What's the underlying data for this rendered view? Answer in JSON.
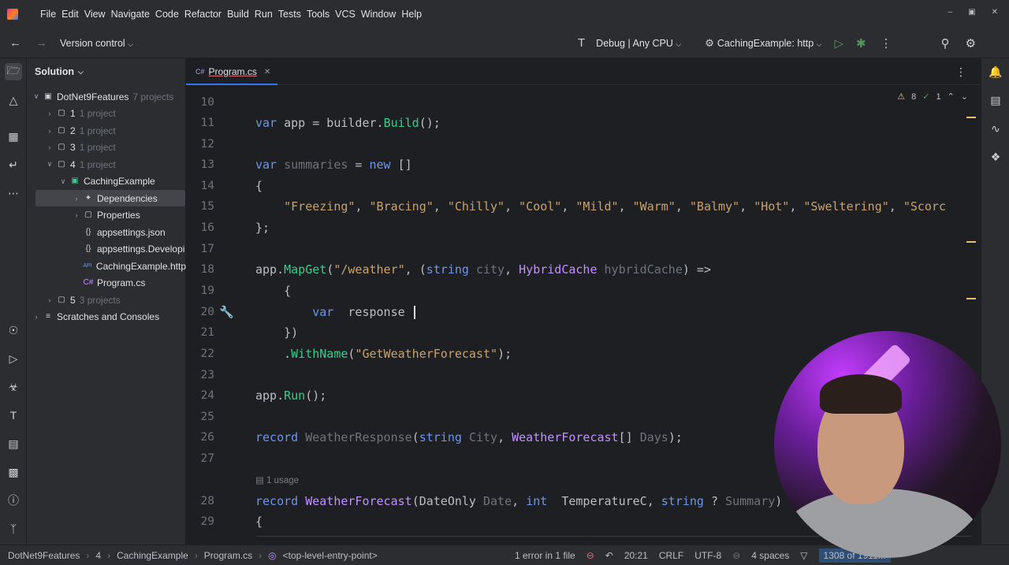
{
  "menu": [
    "File",
    "Edit",
    "View",
    "Navigate",
    "Code",
    "Refactor",
    "Build",
    "Run",
    "Tests",
    "Tools",
    "VCS",
    "Window",
    "Help"
  ],
  "toolbar": {
    "version_control": "Version control",
    "config": "Debug | Any CPU",
    "run_target": "CachingExample: http"
  },
  "project": {
    "title": "Solution",
    "tree": [
      {
        "indent": 0,
        "arrow": "down",
        "icon": "solution-icon",
        "label": "DotNet9Features",
        "hint": "7 projects"
      },
      {
        "indent": 1,
        "arrow": "right",
        "icon": "folder-icon",
        "label": "1",
        "hint": "1 project"
      },
      {
        "indent": 1,
        "arrow": "right",
        "icon": "folder-icon",
        "label": "2",
        "hint": "1 project"
      },
      {
        "indent": 1,
        "arrow": "right",
        "icon": "folder-icon",
        "label": "3",
        "hint": "1 project"
      },
      {
        "indent": 1,
        "arrow": "down",
        "icon": "folder-icon",
        "label": "4",
        "hint": "1 project"
      },
      {
        "indent": 2,
        "arrow": "down",
        "icon": "project-icon",
        "label": "CachingExample",
        "hint": ""
      },
      {
        "indent": 3,
        "arrow": "right",
        "icon": "dependencies-icon",
        "label": "Dependencies",
        "hint": ""
      },
      {
        "indent": 3,
        "arrow": "right",
        "icon": "properties-icon",
        "label": "Properties",
        "hint": ""
      },
      {
        "indent": 3,
        "arrow": "",
        "icon": "json-icon",
        "label": "appsettings.json",
        "hint": ""
      },
      {
        "indent": 3,
        "arrow": "",
        "icon": "json-icon",
        "label": "appsettings.Developi",
        "hint": ""
      },
      {
        "indent": 3,
        "arrow": "",
        "icon": "http-icon",
        "label": "CachingExample.http",
        "hint": ""
      },
      {
        "indent": 3,
        "arrow": "",
        "icon": "csharp-icon",
        "label": "Program.cs",
        "hint": ""
      },
      {
        "indent": 1,
        "arrow": "right",
        "icon": "folder-icon",
        "label": "5",
        "hint": "3 projects"
      },
      {
        "indent": 0,
        "arrow": "right",
        "icon": "scratches-icon",
        "label": "Scratches and Consoles",
        "hint": ""
      }
    ]
  },
  "editor": {
    "tab_label": "Program.cs",
    "tab_prefix": "C#",
    "inspections": {
      "warnings": "8",
      "weak": "1"
    },
    "usage_hint": "1 usage",
    "lines": [
      {
        "n": "10",
        "parts": []
      },
      {
        "n": "11",
        "parts": [
          [
            "kw",
            "var"
          ],
          [
            "",
            "app = builder."
          ],
          [
            "fn",
            "Build"
          ],
          [
            "",
            "();"
          ]
        ]
      },
      {
        "n": "12",
        "parts": []
      },
      {
        "n": "13",
        "parts": [
          [
            "kw",
            "var"
          ],
          [
            "",
            ""
          ],
          [
            "gray",
            "summaries"
          ],
          [
            "",
            " = "
          ],
          [
            "kw",
            "new"
          ],
          [
            "",
            "[]"
          ]
        ]
      },
      {
        "n": "14",
        "parts": [
          [
            "",
            "{"
          ]
        ]
      },
      {
        "n": "15",
        "parts": [
          [
            "",
            "    "
          ],
          [
            "str",
            "\"Freezing\""
          ],
          [
            "",
            ", "
          ],
          [
            "str",
            "\"Bracing\""
          ],
          [
            "",
            ", "
          ],
          [
            "str",
            "\"Chilly\""
          ],
          [
            "",
            ", "
          ],
          [
            "str",
            "\"Cool\""
          ],
          [
            "",
            ", "
          ],
          [
            "str",
            "\"Mild\""
          ],
          [
            "",
            ", "
          ],
          [
            "str",
            "\"Warm\""
          ],
          [
            "",
            ", "
          ],
          [
            "str",
            "\"Balmy\""
          ],
          [
            "",
            ", "
          ],
          [
            "str",
            "\"Hot\""
          ],
          [
            "",
            ", "
          ],
          [
            "str",
            "\"Sweltering\""
          ],
          [
            "",
            ", "
          ],
          [
            "str",
            "\"Scorc"
          ]
        ]
      },
      {
        "n": "16",
        "parts": [
          [
            "",
            "};"
          ]
        ]
      },
      {
        "n": "17",
        "parts": []
      },
      {
        "n": "18",
        "parts": [
          [
            "",
            "app."
          ],
          [
            "fn",
            "MapGet"
          ],
          [
            "",
            "("
          ],
          [
            "str",
            "\"/weather\""
          ],
          [
            "",
            ", ("
          ],
          [
            "kw",
            "string"
          ],
          [
            "",
            ""
          ],
          [
            "gray",
            "city"
          ],
          [
            "",
            ", "
          ],
          [
            "ty",
            "HybridCache"
          ],
          [
            "",
            ""
          ],
          [
            "gray",
            "hybridCache"
          ],
          [
            "",
            ") =>"
          ]
        ]
      },
      {
        "n": "19",
        "parts": [
          [
            "",
            "    {"
          ]
        ]
      },
      {
        "n": "20",
        "parts": [
          [
            "",
            "        "
          ],
          [
            "kw",
            "var"
          ],
          [
            "",
            " response "
          ]
        ]
      },
      {
        "n": "21",
        "parts": [
          [
            "",
            "    })"
          ]
        ]
      },
      {
        "n": "22",
        "parts": [
          [
            "",
            "    ."
          ],
          [
            "fn",
            "WithName"
          ],
          [
            "",
            "("
          ],
          [
            "str",
            "\"GetWeatherForecast\""
          ],
          [
            "",
            ");"
          ]
        ]
      },
      {
        "n": "23",
        "parts": []
      },
      {
        "n": "24",
        "parts": [
          [
            "",
            "app."
          ],
          [
            "fn",
            "Run"
          ],
          [
            "",
            "();"
          ]
        ]
      },
      {
        "n": "25",
        "parts": []
      },
      {
        "n": "26",
        "parts": [
          [
            "kw",
            "record"
          ],
          [
            "",
            ""
          ],
          [
            "gray",
            "WeatherResponse"
          ],
          [
            "",
            "("
          ],
          [
            "kw",
            "string"
          ],
          [
            "",
            ""
          ],
          [
            "gray",
            "City"
          ],
          [
            "",
            ", "
          ],
          [
            "ty",
            "WeatherForecast"
          ],
          [
            "",
            "[] "
          ],
          [
            "gray",
            "Days"
          ],
          [
            "",
            ");"
          ]
        ]
      },
      {
        "n": "27",
        "parts": []
      },
      {
        "n": "28",
        "parts": [
          [
            "kw",
            "record"
          ],
          [
            "",
            ""
          ],
          [
            "ty",
            "WeatherForecast"
          ],
          [
            "",
            "(DateOnly "
          ],
          [
            "gray",
            "Date"
          ],
          [
            "",
            ", "
          ],
          [
            "kw",
            "int"
          ],
          [
            "",
            " TemperatureC, "
          ],
          [
            "kw",
            "string"
          ],
          [
            "",
            "? "
          ],
          [
            "gray",
            "Summary"
          ],
          [
            "",
            ")"
          ]
        ]
      },
      {
        "n": "29",
        "parts": [
          [
            "",
            "{"
          ]
        ]
      }
    ]
  },
  "status": {
    "crumbs": [
      "DotNet9Features",
      "4",
      "CachingExample",
      "Program.cs",
      "<top-level-entry-point>"
    ],
    "errors": "1 error in 1 file",
    "position": "20:21",
    "line_sep": "CRLF",
    "encoding": "UTF-8",
    "indent": "4 spaces",
    "memory": "1308 of 1911M"
  }
}
